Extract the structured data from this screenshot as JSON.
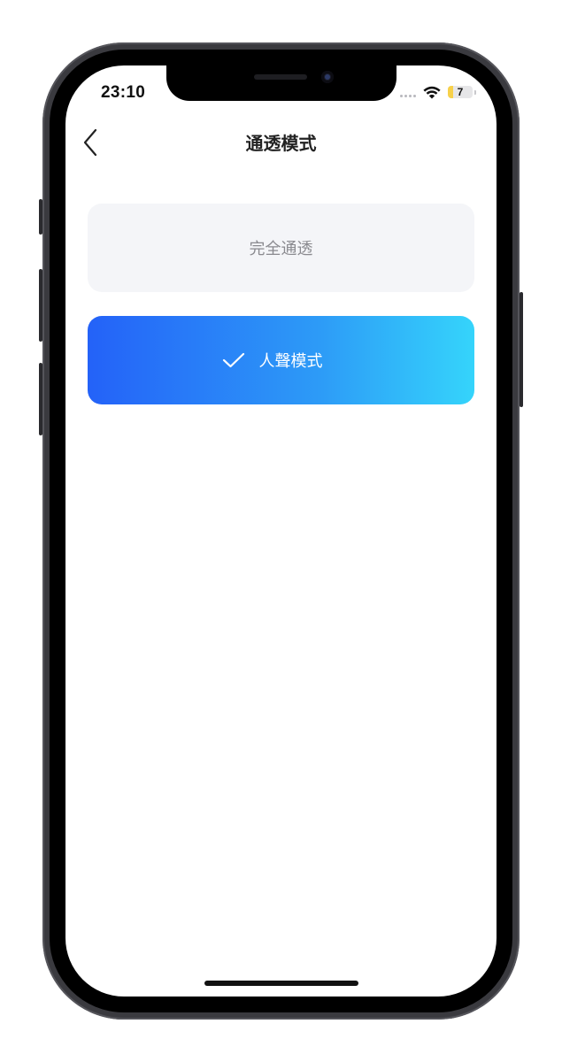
{
  "status_bar": {
    "time": "23:10",
    "battery_level": "7",
    "battery_fraction": 0.07,
    "signal_icon": "signal-dots-icon",
    "wifi_icon": "wifi-icon"
  },
  "header": {
    "title": "通透模式",
    "back_icon": "chevron-left-icon"
  },
  "modes": [
    {
      "label": "完全通透",
      "selected": false
    },
    {
      "label": "人聲模式",
      "selected": true,
      "check_icon": "check-icon"
    }
  ],
  "colors": {
    "selected_gradient_start": "#2462f8",
    "selected_gradient_end": "#35d4fb",
    "unselected_background": "#f4f5f8",
    "unselected_text": "#8a8a8f",
    "selected_text": "#ffffff"
  }
}
